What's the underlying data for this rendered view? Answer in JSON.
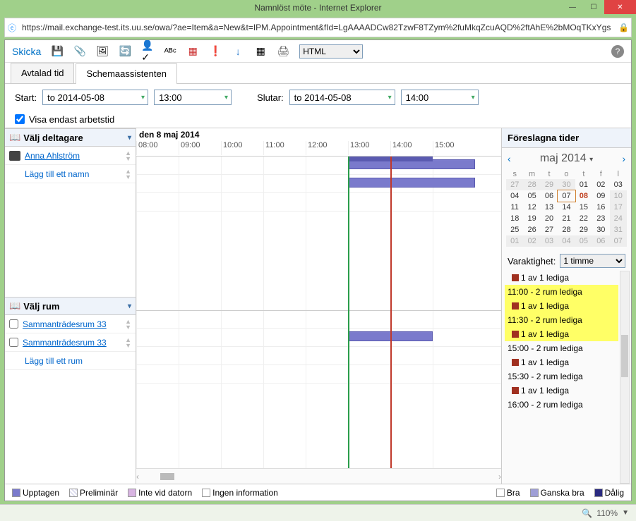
{
  "window": {
    "title": "Namnlöst möte - Internet Explorer",
    "url": "https://mail.exchange-test.its.uu.se/owa/?ae=Item&a=New&t=IPM.Appointment&fId=LgAAAADCw82TzwF8TZym%2fuMkqZcuAQD%2ftAhE%2bMOqTKxYgs"
  },
  "toolbar": {
    "send": "Skicka",
    "format_select": "HTML"
  },
  "tabs": {
    "appointment": "Avtalad tid",
    "scheduling": "Schemaassistenten"
  },
  "datebar": {
    "start_label": "Start:",
    "start_date": "to 2014-05-08",
    "start_time": "13:00",
    "end_label": "Slutar:",
    "end_date": "to 2014-05-08",
    "end_time": "14:00"
  },
  "workhours": {
    "label": "Visa endast arbetstid"
  },
  "attendees": {
    "header": "Välj deltagare",
    "rows": [
      "Anna Ahlström"
    ],
    "add": "Lägg till ett namn"
  },
  "rooms": {
    "header": "Välj rum",
    "rows": [
      "Sammanträdesrum 33",
      "Sammanträdesrum 33"
    ],
    "add": "Lägg till ett rum"
  },
  "timeline": {
    "day_label": "den 8 maj 2014",
    "hours": [
      "08:00",
      "09:00",
      "10:00",
      "11:00",
      "12:00",
      "13:00",
      "14:00",
      "15:00"
    ]
  },
  "suggested": {
    "header": "Föreslagna tider",
    "month": "maj 2014",
    "dow": [
      "s",
      "m",
      "t",
      "o",
      "t",
      "f",
      "l"
    ],
    "weeks": [
      [
        {
          "d": "27",
          "dim": true
        },
        {
          "d": "28",
          "dim": true
        },
        {
          "d": "29",
          "dim": true
        },
        {
          "d": "30",
          "dim": true
        },
        {
          "d": "01"
        },
        {
          "d": "02"
        },
        {
          "d": "03"
        }
      ],
      [
        {
          "d": "04"
        },
        {
          "d": "05"
        },
        {
          "d": "06"
        },
        {
          "d": "07",
          "today": true
        },
        {
          "d": "08",
          "sel": true
        },
        {
          "d": "09"
        },
        {
          "d": "10",
          "dim": true
        }
      ],
      [
        {
          "d": "11"
        },
        {
          "d": "12"
        },
        {
          "d": "13"
        },
        {
          "d": "14"
        },
        {
          "d": "15"
        },
        {
          "d": "16"
        },
        {
          "d": "17",
          "dim": true
        }
      ],
      [
        {
          "d": "18"
        },
        {
          "d": "19"
        },
        {
          "d": "20"
        },
        {
          "d": "21"
        },
        {
          "d": "22"
        },
        {
          "d": "23"
        },
        {
          "d": "24",
          "dim": true
        }
      ],
      [
        {
          "d": "25"
        },
        {
          "d": "26"
        },
        {
          "d": "27"
        },
        {
          "d": "28"
        },
        {
          "d": "29"
        },
        {
          "d": "30"
        },
        {
          "d": "31",
          "dim": true
        }
      ],
      [
        {
          "d": "01",
          "dim": true
        },
        {
          "d": "02",
          "dim": true
        },
        {
          "d": "03",
          "dim": true
        },
        {
          "d": "04",
          "dim": true
        },
        {
          "d": "05",
          "dim": true
        },
        {
          "d": "06",
          "dim": true
        },
        {
          "d": "07",
          "dim": true
        }
      ]
    ],
    "duration_label": "Varaktighet:",
    "duration_value": "1 timme",
    "items": [
      {
        "text": "1 av 1 lediga",
        "sub": true,
        "red": true
      },
      {
        "text": "11:00 - 2 rum lediga",
        "hl": true
      },
      {
        "text": "1 av 1 lediga",
        "sub": true,
        "red": true,
        "hl": true
      },
      {
        "text": "11:30 - 2 rum lediga",
        "hl": true
      },
      {
        "text": "1 av 1 lediga",
        "sub": true,
        "red": true,
        "hl": true
      },
      {
        "text": "15:00 - 2 rum lediga"
      },
      {
        "text": "1 av 1 lediga",
        "sub": true,
        "red": true
      },
      {
        "text": "15:30 - 2 rum lediga"
      },
      {
        "text": "1 av 1 lediga",
        "sub": true,
        "red": true
      },
      {
        "text": "16:00 - 2 rum lediga"
      }
    ]
  },
  "legend": {
    "busy": "Upptagen",
    "tentative": "Preliminär",
    "away": "Inte vid datorn",
    "noinfo": "Ingen information",
    "good": "Bra",
    "ok": "Ganska bra",
    "bad": "Dålig"
  },
  "status": {
    "zoom": "110%"
  }
}
